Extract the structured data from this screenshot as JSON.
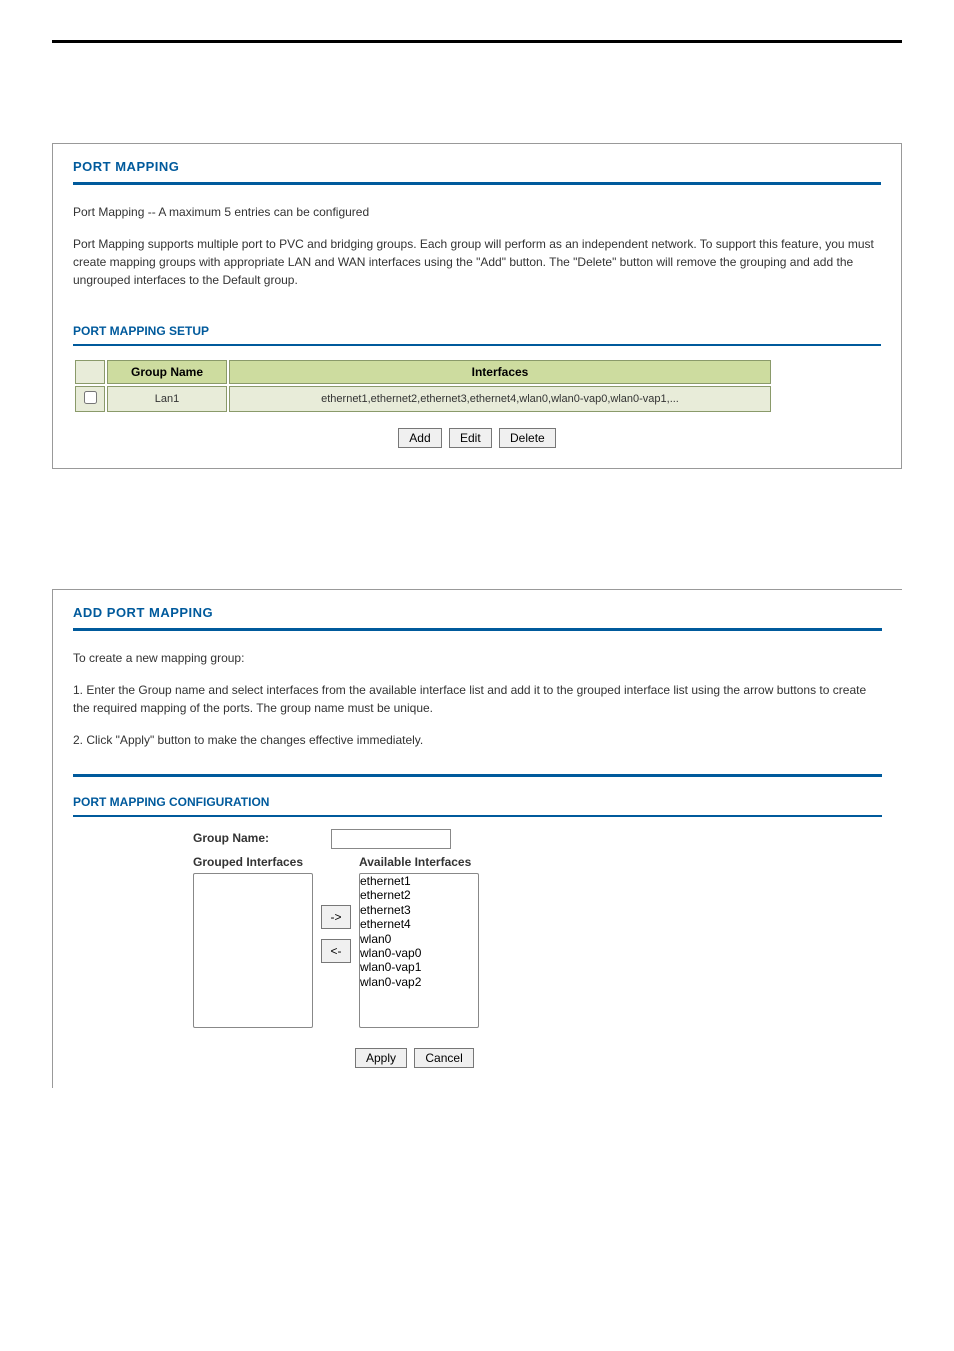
{
  "panel1": {
    "title": "PORT MAPPING",
    "intro": "Port Mapping -- A maximum 5 entries can be configured",
    "desc": "Port Mapping supports multiple port to PVC and bridging groups. Each group will perform as an independent network. To support this feature, you must create mapping groups with appropriate LAN and WAN interfaces using the \"Add\" button. The \"Delete\" button will remove the grouping and add the ungrouped interfaces to the Default group.",
    "setup_title": "PORT MAPPING SETUP",
    "headers": {
      "group": "Group Name",
      "ifaces": "Interfaces"
    },
    "rows": [
      {
        "group": "Lan1",
        "ifaces": "ethernet1,ethernet2,ethernet3,ethernet4,wlan0,wlan0-vap0,wlan0-vap1,..."
      }
    ],
    "buttons": {
      "add": "Add",
      "edit": "Edit",
      "delete": "Delete"
    }
  },
  "panel2": {
    "title": "ADD PORT MAPPING",
    "intro": "To create a new mapping group:",
    "step1": "1. Enter the Group name and select interfaces from the available interface list and add it to the grouped interface list using the arrow buttons to create the required mapping of the ports. The group name must be unique.",
    "step2": "2. Click \"Apply\" button to make the changes effective immediately.",
    "config_title": "PORT MAPPING CONFIGURATION",
    "labels": {
      "group_name": "Group Name:",
      "grouped": "Grouped Interfaces",
      "available": "Available Interfaces"
    },
    "available_interfaces": [
      "ethernet1",
      "ethernet2",
      "ethernet3",
      "ethernet4",
      "wlan0",
      "wlan0-vap0",
      "wlan0-vap1",
      "wlan0-vap2"
    ],
    "grouped_interfaces": [],
    "arrows": {
      "right": "->",
      "left": "<-"
    },
    "buttons": {
      "apply": "Apply",
      "cancel": "Cancel"
    }
  }
}
